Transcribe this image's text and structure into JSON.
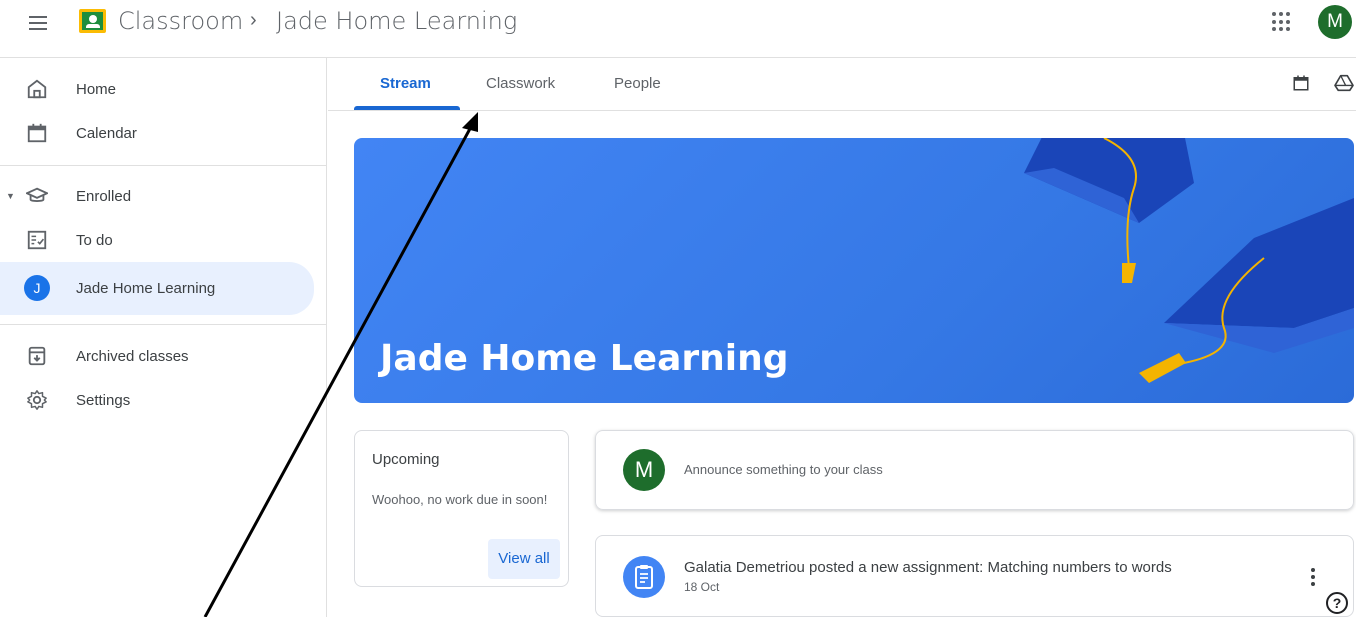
{
  "header": {
    "app_title": "Classroom",
    "separator": "›",
    "class_name": "Jade Home Learning",
    "avatar_letter": "M"
  },
  "sidebar": {
    "items": [
      {
        "label": "Home",
        "icon": "home-icon"
      },
      {
        "label": "Calendar",
        "icon": "calendar-icon"
      },
      {
        "label": "Enrolled",
        "icon": "graduation-cap-icon"
      },
      {
        "label": "To do",
        "icon": "todo-checklist-icon"
      },
      {
        "label": "Jade Home Learning",
        "icon": "class-avatar",
        "avatar_letter": "J",
        "active": true
      },
      {
        "label": "Archived classes",
        "icon": "archive-icon"
      },
      {
        "label": "Settings",
        "icon": "gear-icon"
      }
    ]
  },
  "tabs": [
    {
      "label": "Stream",
      "active": true
    },
    {
      "label": "Classwork",
      "active": false
    },
    {
      "label": "People",
      "active": false
    }
  ],
  "banner": {
    "title": "Jade Home Learning",
    "color": "#4285f4"
  },
  "upcoming": {
    "title": "Upcoming",
    "message": "Woohoo, no work due in soon!",
    "view_all_label": "View all"
  },
  "announce": {
    "avatar_letter": "M",
    "placeholder": "Announce something to your class"
  },
  "post": {
    "title": "Galatia Demetriou posted a new assignment: Matching numbers to words",
    "date": "18 Oct"
  },
  "colors": {
    "accent": "#1967d2",
    "avatar_green": "#1e6d2c",
    "active_nav_bg": "#e8f0fe"
  }
}
